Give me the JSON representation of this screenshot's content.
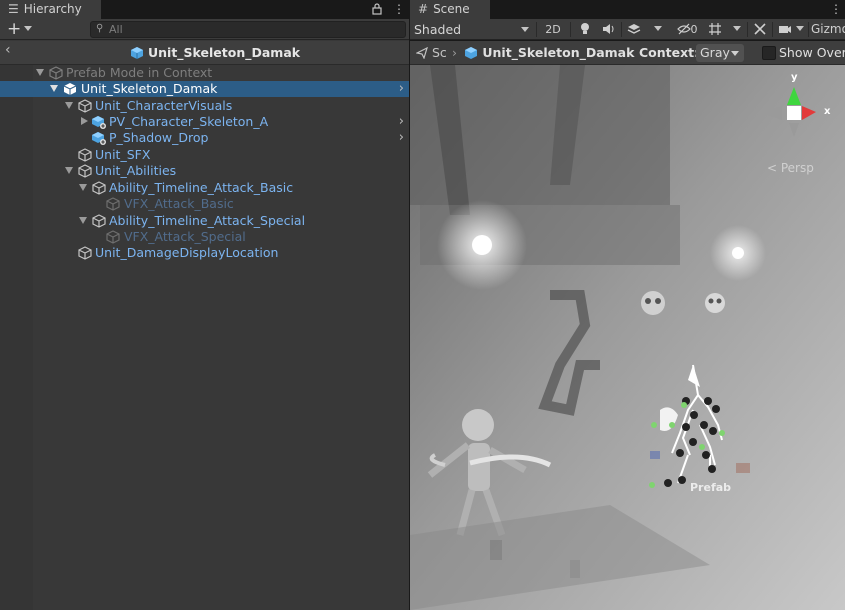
{
  "hierarchy": {
    "tab_label": "Hierarchy",
    "search_placeholder": "All",
    "breadcrumb_title": "Unit_Skeleton_Damak",
    "rows": [
      {
        "label": "Prefab Mode in Context",
        "state": "dim"
      },
      {
        "label": "Unit_Skeleton_Damak",
        "state": "selected"
      },
      {
        "label": "Unit_CharacterVisuals",
        "state": "blue"
      },
      {
        "label": "PV_Character_Skeleton_A",
        "state": "blue"
      },
      {
        "label": "P_Shadow_Drop",
        "state": "blue"
      },
      {
        "label": "Unit_SFX",
        "state": "blue"
      },
      {
        "label": "Unit_Abilities",
        "state": "blue"
      },
      {
        "label": "Ability_Timeline_Attack_Basic",
        "state": "blue"
      },
      {
        "label": "VFX_Attack_Basic",
        "state": "faded"
      },
      {
        "label": "Ability_Timeline_Attack_Special",
        "state": "blue"
      },
      {
        "label": "VFX_Attack_Special",
        "state": "faded"
      },
      {
        "label": "Unit_DamageDisplayLocation",
        "state": "blue"
      }
    ]
  },
  "scene": {
    "tab_label": "Scene",
    "shading_mode": "Shaded",
    "mode_2d_label": "2D",
    "hidden_count": "0",
    "gizmos_label": "Gizmo",
    "breadcrumb_root": "Sc",
    "breadcrumb_current": "Unit_Skeleton_Damak",
    "context_label": "Context:",
    "context_value": "Gray",
    "show_overrides_label": "Show Overr",
    "axis_y": "y",
    "axis_x": "x",
    "persp_label": "< Persp",
    "prefab_label": "Prefab"
  },
  "colors": {
    "selection": "#2c5d87",
    "prefab_blue": "#7cb4f0",
    "gizmo_y": "#3fd63f",
    "gizmo_x": "#e23a3a"
  }
}
